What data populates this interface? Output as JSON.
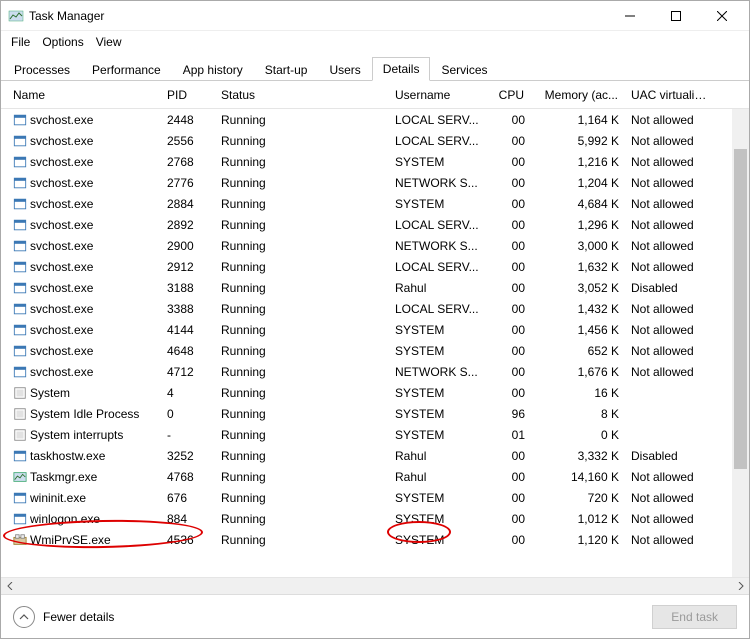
{
  "window": {
    "title": "Task Manager"
  },
  "menu": {
    "items": [
      "File",
      "Options",
      "View"
    ]
  },
  "tabs": [
    "Processes",
    "Performance",
    "App history",
    "Start-up",
    "Users",
    "Details",
    "Services"
  ],
  "active_tab_index": 5,
  "columns": [
    "Name",
    "PID",
    "Status",
    "Username",
    "CPU",
    "Memory (ac...",
    "UAC virtualisati..."
  ],
  "processes": [
    {
      "name": "svchost.exe",
      "pid": "2448",
      "status": "Running",
      "user": "LOCAL SERV...",
      "cpu": "00",
      "mem": "1,164 K",
      "uac": "Not allowed",
      "icon": "svc"
    },
    {
      "name": "svchost.exe",
      "pid": "2556",
      "status": "Running",
      "user": "LOCAL SERV...",
      "cpu": "00",
      "mem": "5,992 K",
      "uac": "Not allowed",
      "icon": "svc"
    },
    {
      "name": "svchost.exe",
      "pid": "2768",
      "status": "Running",
      "user": "SYSTEM",
      "cpu": "00",
      "mem": "1,216 K",
      "uac": "Not allowed",
      "icon": "svc"
    },
    {
      "name": "svchost.exe",
      "pid": "2776",
      "status": "Running",
      "user": "NETWORK S...",
      "cpu": "00",
      "mem": "1,204 K",
      "uac": "Not allowed",
      "icon": "svc"
    },
    {
      "name": "svchost.exe",
      "pid": "2884",
      "status": "Running",
      "user": "SYSTEM",
      "cpu": "00",
      "mem": "4,684 K",
      "uac": "Not allowed",
      "icon": "svc"
    },
    {
      "name": "svchost.exe",
      "pid": "2892",
      "status": "Running",
      "user": "LOCAL SERV...",
      "cpu": "00",
      "mem": "1,296 K",
      "uac": "Not allowed",
      "icon": "svc"
    },
    {
      "name": "svchost.exe",
      "pid": "2900",
      "status": "Running",
      "user": "NETWORK S...",
      "cpu": "00",
      "mem": "3,000 K",
      "uac": "Not allowed",
      "icon": "svc"
    },
    {
      "name": "svchost.exe",
      "pid": "2912",
      "status": "Running",
      "user": "LOCAL SERV...",
      "cpu": "00",
      "mem": "1,632 K",
      "uac": "Not allowed",
      "icon": "svc"
    },
    {
      "name": "svchost.exe",
      "pid": "3188",
      "status": "Running",
      "user": "Rahul",
      "cpu": "00",
      "mem": "3,052 K",
      "uac": "Disabled",
      "icon": "svc"
    },
    {
      "name": "svchost.exe",
      "pid": "3388",
      "status": "Running",
      "user": "LOCAL SERV...",
      "cpu": "00",
      "mem": "1,432 K",
      "uac": "Not allowed",
      "icon": "svc"
    },
    {
      "name": "svchost.exe",
      "pid": "4144",
      "status": "Running",
      "user": "SYSTEM",
      "cpu": "00",
      "mem": "1,456 K",
      "uac": "Not allowed",
      "icon": "svc"
    },
    {
      "name": "svchost.exe",
      "pid": "4648",
      "status": "Running",
      "user": "SYSTEM",
      "cpu": "00",
      "mem": "652 K",
      "uac": "Not allowed",
      "icon": "svc"
    },
    {
      "name": "svchost.exe",
      "pid": "4712",
      "status": "Running",
      "user": "NETWORK S...",
      "cpu": "00",
      "mem": "1,676 K",
      "uac": "Not allowed",
      "icon": "svc"
    },
    {
      "name": "System",
      "pid": "4",
      "status": "Running",
      "user": "SYSTEM",
      "cpu": "00",
      "mem": "16 K",
      "uac": "",
      "icon": "sys"
    },
    {
      "name": "System Idle Process",
      "pid": "0",
      "status": "Running",
      "user": "SYSTEM",
      "cpu": "96",
      "mem": "8 K",
      "uac": "",
      "icon": "sys"
    },
    {
      "name": "System interrupts",
      "pid": "-",
      "status": "Running",
      "user": "SYSTEM",
      "cpu": "01",
      "mem": "0 K",
      "uac": "",
      "icon": "sys"
    },
    {
      "name": "taskhostw.exe",
      "pid": "3252",
      "status": "Running",
      "user": "Rahul",
      "cpu": "00",
      "mem": "3,332 K",
      "uac": "Disabled",
      "icon": "svc"
    },
    {
      "name": "Taskmgr.exe",
      "pid": "4768",
      "status": "Running",
      "user": "Rahul",
      "cpu": "00",
      "mem": "14,160 K",
      "uac": "Not allowed",
      "icon": "tm"
    },
    {
      "name": "wininit.exe",
      "pid": "676",
      "status": "Running",
      "user": "SYSTEM",
      "cpu": "00",
      "mem": "720 K",
      "uac": "Not allowed",
      "icon": "svc"
    },
    {
      "name": "winlogon.exe",
      "pid": "884",
      "status": "Running",
      "user": "SYSTEM",
      "cpu": "00",
      "mem": "1,012 K",
      "uac": "Not allowed",
      "icon": "svc"
    },
    {
      "name": "WmiPrvSE.exe",
      "pid": "4536",
      "status": "Running",
      "user": "SYSTEM",
      "cpu": "00",
      "mem": "1,120 K",
      "uac": "Not allowed",
      "icon": "wmi"
    }
  ],
  "footer": {
    "fewer_details": "Fewer details",
    "end_task": "End task"
  }
}
